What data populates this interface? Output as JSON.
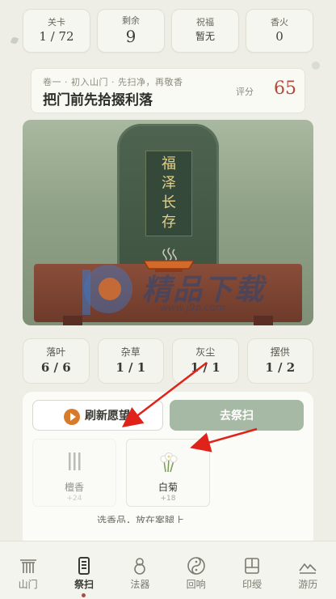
{
  "stats": [
    {
      "label": "关卡",
      "value": "1 / 72"
    },
    {
      "label": "剩余",
      "value": "9"
    },
    {
      "label": "祝福",
      "value": "暂无"
    },
    {
      "label": "香火",
      "value": "0"
    }
  ],
  "level": {
    "subtitle": "卷一 · 初入山门 · 先扫净，再敬香",
    "title": "把门前先拾掇利落",
    "score_label": "评分",
    "score": "65"
  },
  "scene": {
    "plaque_chars": [
      "福",
      "泽",
      "长",
      "存"
    ]
  },
  "watermark": {
    "text": "精品下载",
    "url": "www.j9p.com"
  },
  "resources": [
    {
      "label": "落叶",
      "value": "6 / 6"
    },
    {
      "label": "杂草",
      "value": "1 / 1"
    },
    {
      "label": "灰尘",
      "value": "1 / 1"
    },
    {
      "label": "摆供",
      "value": "1 / 2"
    }
  ],
  "actions": {
    "refresh": "刷新愿望",
    "sweep": "去祭扫"
  },
  "items": [
    {
      "name": "檀香",
      "bonus": "+24"
    },
    {
      "name": "白菊",
      "bonus": "+18"
    }
  ],
  "hint": "选香品，放在案腿上",
  "nav": [
    {
      "label": "山门",
      "icon": "gate-icon"
    },
    {
      "label": "祭扫",
      "icon": "tablet-icon"
    },
    {
      "label": "法器",
      "icon": "gourd-icon"
    },
    {
      "label": "回响",
      "icon": "yinyang-icon"
    },
    {
      "label": "印绶",
      "icon": "seal-icon"
    },
    {
      "label": "游历",
      "icon": "mountain-icon"
    }
  ],
  "colors": {
    "accent": "#b34a3a",
    "sweep_button": "#a5b9a4",
    "refresh_icon": "#d77a2a",
    "arrow": "#e0231a"
  }
}
